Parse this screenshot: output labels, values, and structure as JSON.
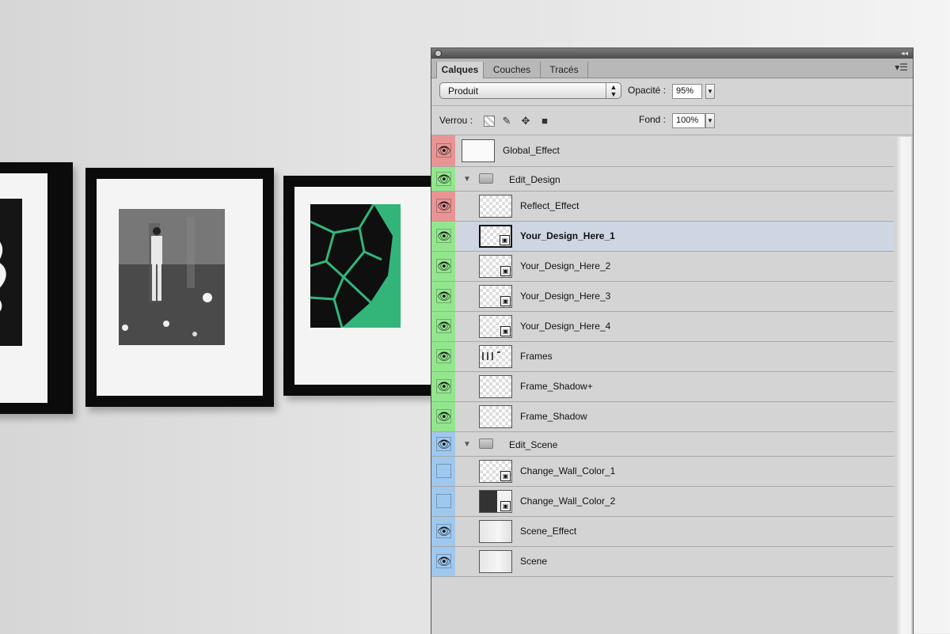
{
  "panel": {
    "tabs": [
      {
        "label": "Calques",
        "active": true
      },
      {
        "label": "Couches",
        "active": false
      },
      {
        "label": "Tracés",
        "active": false
      }
    ],
    "blend_mode": "Produit",
    "opacity_label": "Opacité :",
    "opacity_value": "95%",
    "lock_label": "Verrou :",
    "fill_label": "Fond :",
    "fill_value": "100%",
    "colors": {
      "red_group": "#e99494",
      "green_group": "#93e68e",
      "blue_group": "#9fc8ef",
      "selected_row": "#cdd6e2"
    }
  },
  "layers": [
    {
      "name": "Global_Effect",
      "color": "red",
      "visible": true,
      "thumb": "plain"
    },
    {
      "name": "Edit_Design",
      "color": "green",
      "visible": true,
      "group": true
    },
    {
      "name": "Reflect_Effect",
      "color": "red",
      "visible": true,
      "thumb": "checker"
    },
    {
      "name": "Your_Design_Here_1",
      "color": "green",
      "visible": true,
      "thumb": "checker-smart",
      "selected": true
    },
    {
      "name": "Your_Design_Here_2",
      "color": "green",
      "visible": true,
      "thumb": "checker-smart"
    },
    {
      "name": "Your_Design_Here_3",
      "color": "green",
      "visible": true,
      "thumb": "checker-smart"
    },
    {
      "name": "Your_Design_Here_4",
      "color": "green",
      "visible": true,
      "thumb": "checker-smart"
    },
    {
      "name": "Frames",
      "color": "green",
      "visible": true,
      "thumb": "checker"
    },
    {
      "name": "Frame_Shadow+",
      "color": "green",
      "visible": true,
      "thumb": "checker"
    },
    {
      "name": "Frame_Shadow",
      "color": "green",
      "visible": true,
      "thumb": "checker"
    },
    {
      "name": "Edit_Scene",
      "color": "blue",
      "visible": true,
      "group": true
    },
    {
      "name": "Change_Wall_Color_1",
      "color": "blue",
      "visible": false,
      "thumb": "checker-smart"
    },
    {
      "name": "Change_Wall_Color_2",
      "color": "blue",
      "visible": false,
      "thumb": "dark-smart"
    },
    {
      "name": "Scene_Effect",
      "color": "blue",
      "visible": true,
      "thumb": "gray"
    },
    {
      "name": "Scene",
      "color": "blue",
      "visible": true,
      "thumb": "gray"
    }
  ]
}
